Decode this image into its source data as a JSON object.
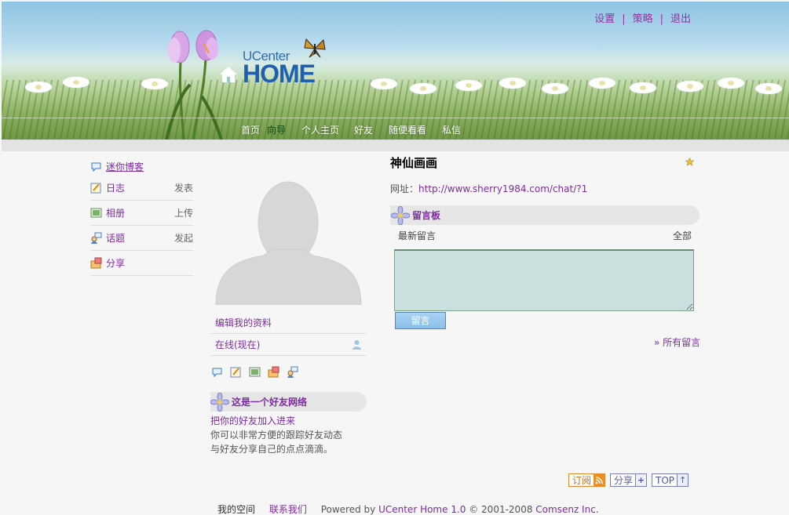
{
  "header": {
    "top_links": [
      {
        "label": "设置"
      },
      {
        "label": "策略"
      },
      {
        "label": "退出"
      }
    ],
    "logo": {
      "line1": "UCenter",
      "line2": "HOME"
    },
    "nav": [
      {
        "label": "首页",
        "active": false
      },
      {
        "label": "向导",
        "active": true
      },
      {
        "label": "个人主页",
        "active": false
      },
      {
        "label": "好友",
        "active": false
      },
      {
        "label": "随便看看",
        "active": false
      },
      {
        "label": "私信",
        "active": false
      }
    ]
  },
  "left_menu": {
    "blog_link": "迷你博客",
    "items": [
      {
        "label": "日志",
        "action": "发表",
        "icon": "diary-icon"
      },
      {
        "label": "相册",
        "action": "上传",
        "icon": "photo-album-icon"
      },
      {
        "label": "话题",
        "action": "发起",
        "icon": "topic-icon"
      },
      {
        "label": "分享",
        "action": "",
        "icon": "share-icon"
      }
    ]
  },
  "profile": {
    "edit_link": "编辑我的资料",
    "online_status": "在线(现在)"
  },
  "friend_network": {
    "title": "这是一个好友网络",
    "link": "把你的好友加入进来",
    "line1": "你可以非常方便的跟踪好友动态",
    "line2": "与好友分享自己的点点滴滴。"
  },
  "main": {
    "title": "神仙画画",
    "url_label": "网址：",
    "url": "http://www.sherry1984.com/chat/?1",
    "board_title": "留言板",
    "latest_label": "最新留言",
    "all_label": "全部",
    "post_button": "留言",
    "all_messages": "» 所有留言"
  },
  "bottom_buttons": {
    "subscribe": "订阅",
    "share": "分享",
    "top": "TOP"
  },
  "footer": {
    "my_space": "我的空间",
    "contact": "联系我们",
    "powered_by": "Powered by",
    "product": "UCenter Home 1.0",
    "copyright": "© 2001-2008",
    "company": "Comsenz Inc."
  },
  "colors": {
    "link_purple": "#7d2ca0",
    "logo_blue": "#1f5fb0",
    "message_box": "#c9e0de"
  }
}
